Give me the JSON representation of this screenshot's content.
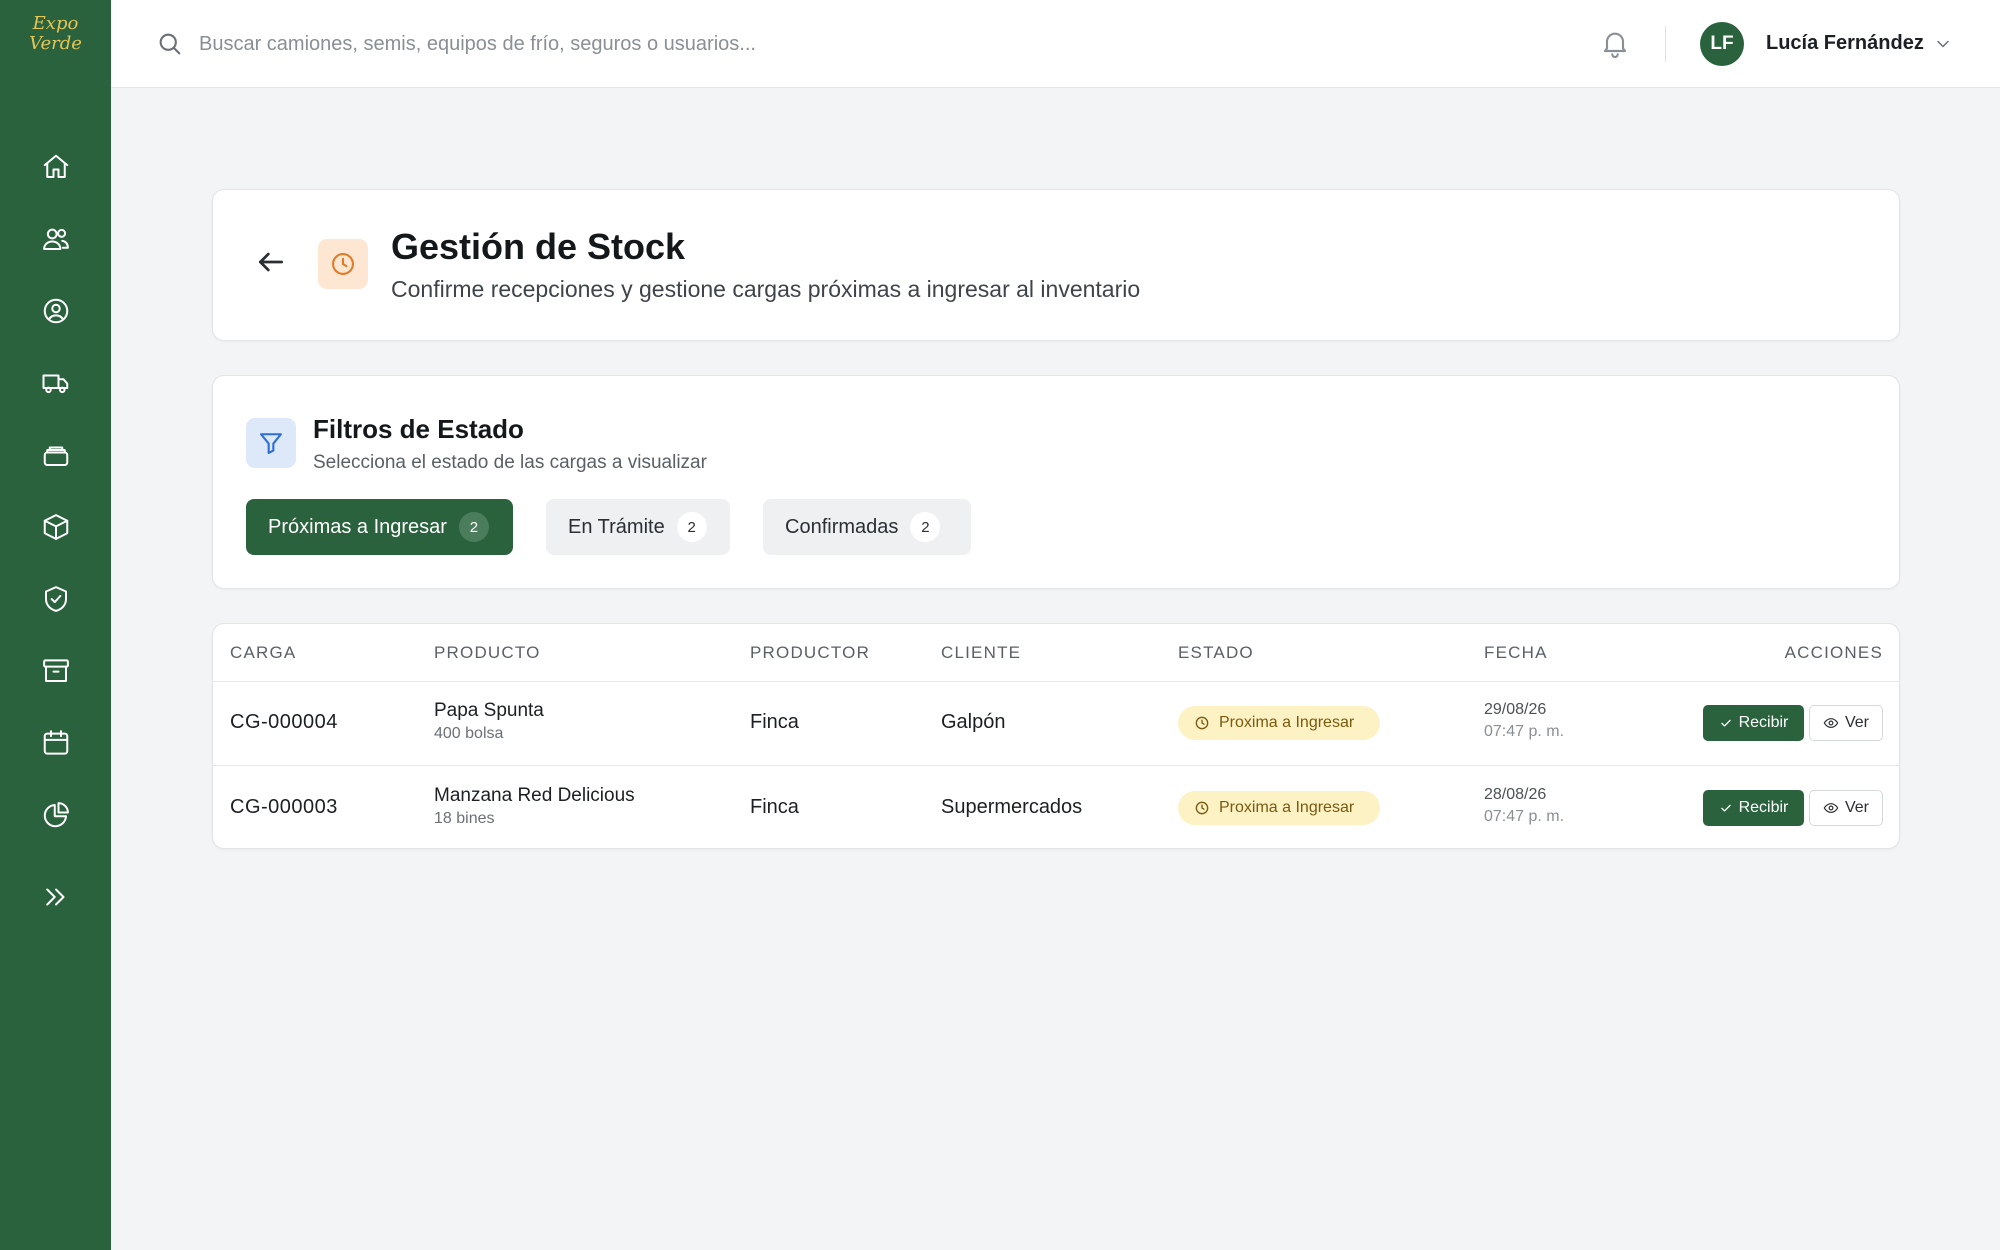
{
  "brand": {
    "logo_line1": "Expo",
    "logo_line2": "Verde"
  },
  "search": {
    "placeholder": "Buscar camiones, semis, equipos de frío, seguros o usuarios..."
  },
  "user": {
    "initials": "LF",
    "name": "Lucía Fernández"
  },
  "sidebar": {
    "items": [
      {
        "icon": "home-icon"
      },
      {
        "icon": "users-icon"
      },
      {
        "icon": "user-circle-icon"
      },
      {
        "icon": "truck-icon"
      },
      {
        "icon": "layers-icon"
      },
      {
        "icon": "box-icon"
      },
      {
        "icon": "shield-check-icon"
      },
      {
        "icon": "archive-icon"
      },
      {
        "icon": "calendar-icon"
      },
      {
        "icon": "pie-chart-icon"
      },
      {
        "icon": "chevrons-right-icon"
      }
    ]
  },
  "header": {
    "title": "Gestión de Stock",
    "subtitle": "Confirme recepciones y gestione cargas próximas a ingresar al inventario"
  },
  "filters": {
    "title": "Filtros de Estado",
    "subtitle": "Selecciona el estado de las cargas a visualizar",
    "chips": [
      {
        "label": "Próximas a Ingresar",
        "count": "2",
        "active": true
      },
      {
        "label": "En Trámite",
        "count": "2",
        "active": false
      },
      {
        "label": "Confirmadas",
        "count": "2",
        "active": false
      }
    ]
  },
  "table": {
    "headers": [
      "CARGA",
      "PRODUCTO",
      "PRODUCTOR",
      "CLIENTE",
      "ESTADO",
      "FECHA",
      "ACCIONES"
    ],
    "rows": [
      {
        "carga": "CG-000004",
        "producto": "Papa Spunta",
        "cantidad": "400 bolsa",
        "productor": "Finca",
        "cliente": "Galpón",
        "estado": "Proxima a Ingresar",
        "fecha": "29/08/26",
        "hora": "07:47 p. m.",
        "accion_recibir": "Recibir",
        "accion_ver": "Ver"
      },
      {
        "carga": "CG-000003",
        "producto": "Manzana Red Delicious",
        "cantidad": "18 bines",
        "productor": "Finca",
        "cliente": "Supermercados",
        "estado": "Proxima a Ingresar",
        "fecha": "28/08/26",
        "hora": "07:47 p. m.",
        "accion_recibir": "Recibir",
        "accion_ver": "Ver"
      }
    ]
  },
  "colors": {
    "brand_green": "#2a623d",
    "background": "#f3f4f5",
    "status_pending_bg": "#fdf2c4",
    "status_pending_text": "#7a5a10",
    "stock_icon_bg": "#fde7d2",
    "filter_icon_bg": "#dde8f8"
  }
}
